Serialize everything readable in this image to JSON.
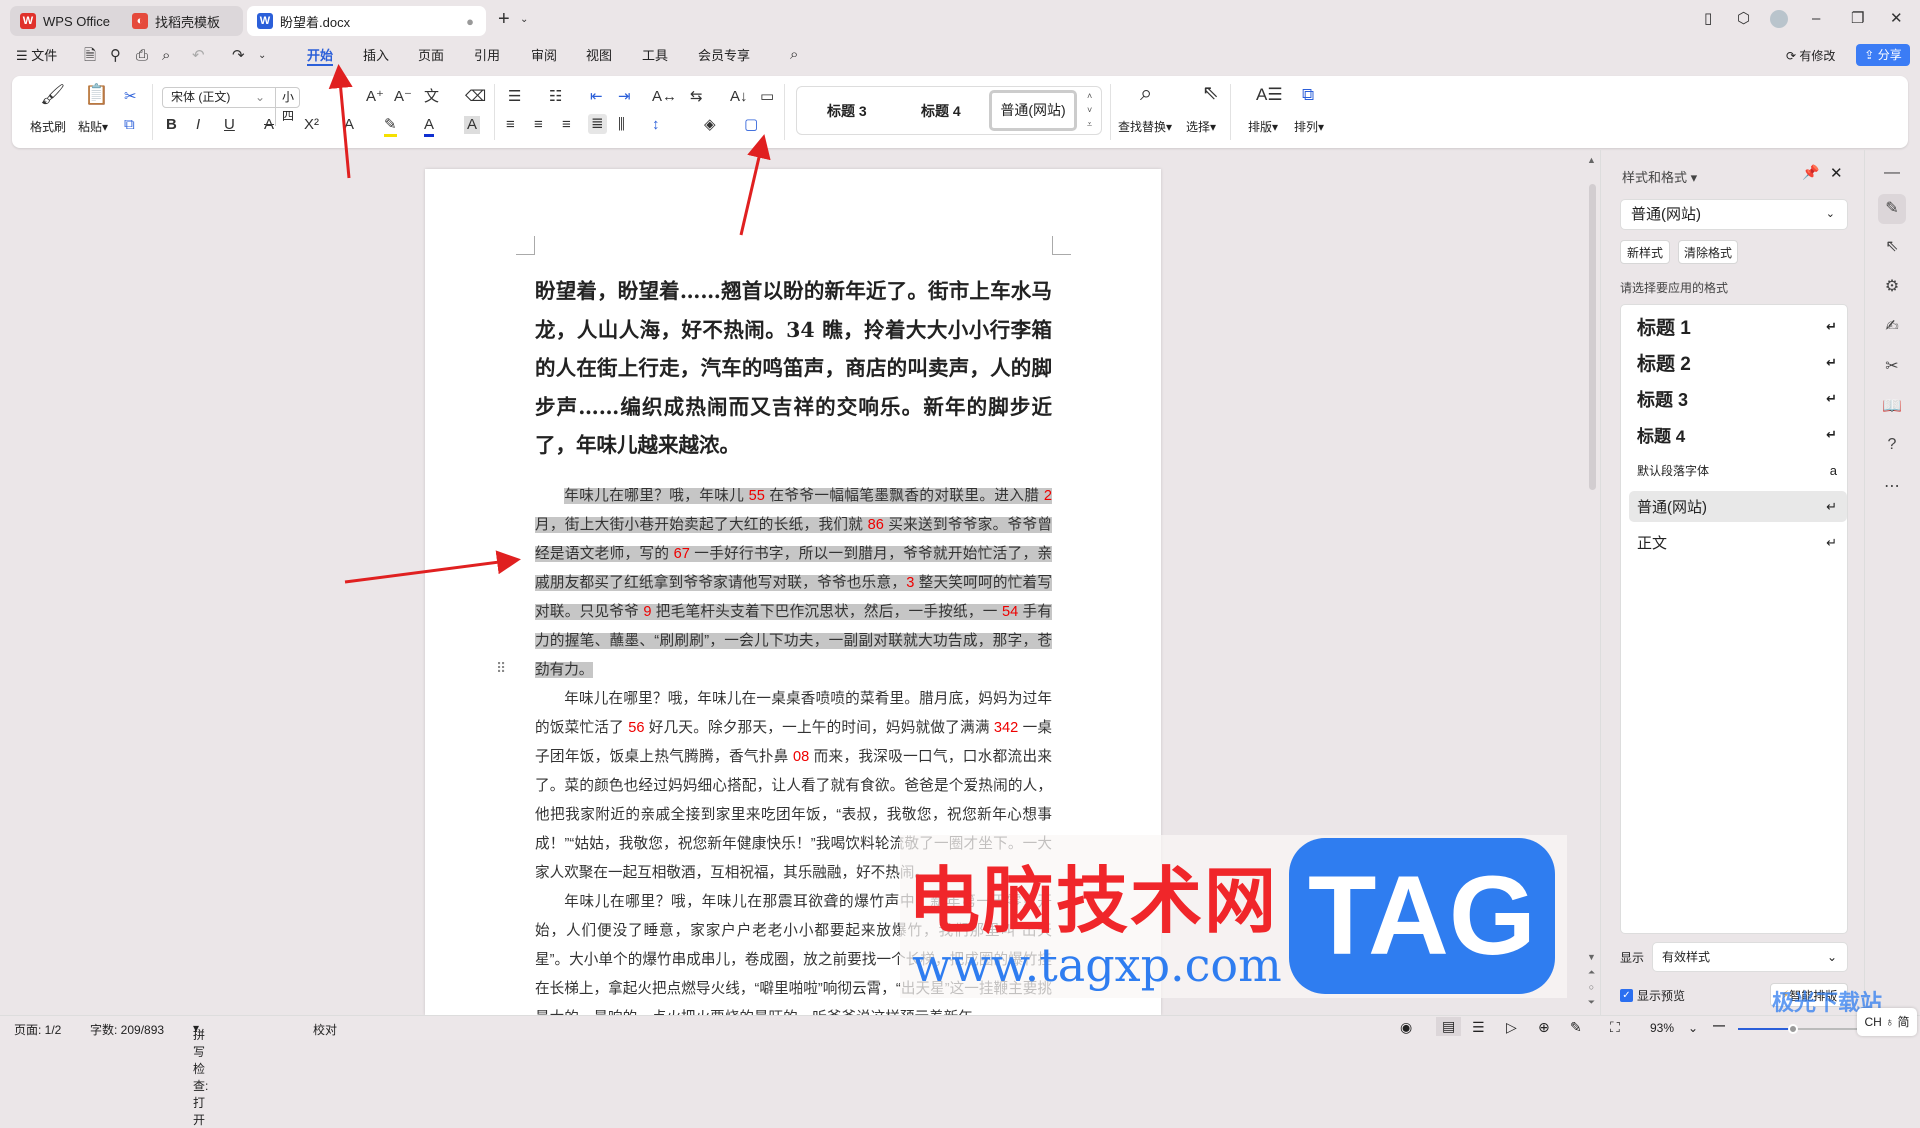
{
  "tabs": [
    {
      "label": "WPS Office"
    },
    {
      "label": "找稻壳模板"
    },
    {
      "label": "盼望着.docx"
    }
  ],
  "menu": {
    "file": "文件",
    "items": [
      "开始",
      "插入",
      "页面",
      "引用",
      "审阅",
      "视图",
      "工具",
      "会员专享"
    ],
    "modified": "有修改",
    "share": "分享"
  },
  "ribbon": {
    "format_painter": "格式刷",
    "paste": "粘贴",
    "font": "宋体 (正文)",
    "size": "小四",
    "styles": [
      "标题 3",
      "标题 4",
      "普通(网站)"
    ],
    "find_replace": "查找替换",
    "select": "选择",
    "layout": "排版",
    "arrange": "排列"
  },
  "doc": {
    "title": "盼望着，盼望着……翘首以盼的新年近了。街市上车水马龙，人山人海，好不热闹。34 瞧，拎着大大小小行李箱的人在街上行走，汽车的鸣笛声，商店的叫卖声，人的脚步声……编织成热闹而又吉祥的交响乐。新年的脚步近了，年味儿越来越浓。",
    "paragraphs": [
      {
        "selected": true,
        "segments": [
          {
            "t": "年味儿在哪里？哦，年味儿 "
          },
          {
            "t": "55",
            "red": true
          },
          {
            "t": " 在爷爷一幅幅笔墨飘香的对联里。进入腊 "
          },
          {
            "t": "2",
            "red": true
          },
          {
            "t": " 月，街上大街小巷开始卖起了大红的长纸，我们就 "
          },
          {
            "t": "86",
            "red": true
          },
          {
            "t": " 买来送到爷爷家。爷爷曾经是语文老师，写的 "
          },
          {
            "t": "67",
            "red": true
          },
          {
            "t": " 一手好行书字，所以一到腊月，爷爷就开始忙活了，亲戚朋友都买了红纸拿到爷爷家请他写对联，爷爷也乐意，"
          },
          {
            "t": "3",
            "red": true
          },
          {
            "t": " 整天笑呵呵的忙着写对联。只见爷爷 "
          },
          {
            "t": "9",
            "red": true
          },
          {
            "t": " 把毛笔杆头支着下巴作沉思状，然后，一手按纸，一 "
          },
          {
            "t": "54",
            "red": true
          },
          {
            "t": " 手有力的握笔、蘸墨、“刷刷刷”，一会儿下功夫，一副副对联就大功告成，那字，苍劲有力。"
          }
        ]
      },
      {
        "selected": false,
        "segments": [
          {
            "t": "年味儿在哪里？哦，年味儿在一桌桌香喷喷的菜肴里。腊月底，妈妈为过年的饭菜忙活了 "
          },
          {
            "t": "56",
            "red": true
          },
          {
            "t": " 好几天。除夕那天，一上午的时间，妈妈就做了满满 "
          },
          {
            "t": "342",
            "red": true
          },
          {
            "t": " 一桌子团年饭，饭桌上热气腾腾，香气扑鼻 "
          },
          {
            "t": "08",
            "red": true
          },
          {
            "t": " 而来，我深吸一口气，口水都流出来了。菜的颜色也经过妈妈细心搭配，让人看了就有食欲。爸爸是个爱热闹的人，他把我家附近的亲戚全接到家里来吃团年饭，“表叔，我敬您，祝您新年心想事成！”“姑姑，我敬您，祝您新年健康快乐！”我喝饮料轮流敬了一圈才坐下。一大家人欢聚在一起互相敬酒，互相祝福，其乐融融，好不热闹。"
          }
        ]
      },
      {
        "selected": false,
        "segments": [
          {
            "t": "年味儿在哪里？哦，年味儿在那震耳欲聋的爆竹声中。新年第一天零点开始，人们便没了睡意，家家户户老老小小都要起来放爆竹，我们那里叫“出天星”。大小单个的爆竹串成串儿，卷成圈，放之前要找一个长梯，把成圈的爆竹挂在长梯上，拿起火把点燃导火线，“噼里啪啦”响彻云霄，“出天星”这一挂鞭主要挑最大的，最响的，点火把火要烧的最旺的，听爷爷说这样预示着新年"
          }
        ]
      }
    ]
  },
  "panel": {
    "title": "样式和格式",
    "current": "普通(网站)",
    "new_style": "新样式",
    "clear": "清除格式",
    "prompt": "请选择要应用的格式",
    "items": [
      "标题  1",
      "标题  2",
      "标题  3",
      "标题 4",
      "默认段落字体",
      "普通(网站)",
      "正文"
    ],
    "show_label": "显示",
    "show_value": "有效样式",
    "preview": "显示预览",
    "smart": "智能排版"
  },
  "status": {
    "page": "页面: 1/2",
    "words": "字数: 209/893",
    "spell": "拼写检查: 打开",
    "proof": "校对",
    "zoom": "93%",
    "ime": "CH ♁ 简"
  },
  "watermark": {
    "cn": "电脑技术网",
    "tag": "TAG",
    "url": "www.tagxp.com",
    "site": "极光下载站"
  },
  "colors": {
    "accent": "#2b5fd9",
    "annotation": "#e02020",
    "selection": "#c6c6c6"
  }
}
